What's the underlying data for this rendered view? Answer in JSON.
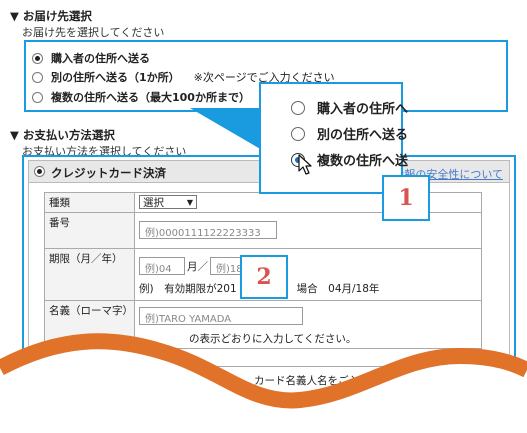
{
  "shipping": {
    "title": "▼ お届け先選択",
    "subtitle": "お届け先を選択してください",
    "options": [
      {
        "label": "購入者の住所へ送る",
        "note": "",
        "selected": true
      },
      {
        "label": "別の住所へ送る（1か所）",
        "note": "※次ページでご入力ください",
        "selected": false
      },
      {
        "label": "複数の住所へ送る（最大100か所まで）",
        "note": "※",
        "selected": false
      }
    ]
  },
  "zoom": {
    "options": [
      {
        "label": "購入者の住所へ",
        "selected": false
      },
      {
        "label": "別の住所へ送る",
        "selected": false
      },
      {
        "label": "複数の住所へ送",
        "selected": true
      }
    ],
    "badge": "1"
  },
  "payment": {
    "title": "▼ お支払い方法選択",
    "subtitle": "お支払い方法を選択してください",
    "method_label": "クレジットカード決済",
    "security_link": "青報の安全性について",
    "rows": {
      "type_label": "種類",
      "type_value": "選択",
      "number_label": "番号",
      "number_placeholder": "例)0000111122223333",
      "expiry_label": "期限（月／年）",
      "month_placeholder": "例)04",
      "month_sep": "月／",
      "year_placeholder": "例)18",
      "expiry_example_prefix": "例)　有効期限が201",
      "expiry_example_suffix": "場合　04月/18年",
      "name_label": "名義（ローマ字）",
      "name_placeholder": "例)TARO YAMADA",
      "name_hint": "の表示どおりに入力してください。",
      "footer_note": "カード名義人名をご入力ください。"
    },
    "badge": "2"
  },
  "colors": {
    "accent": "#1a9be0",
    "badge_number": "#d9534f",
    "wave": "#e0722a"
  }
}
